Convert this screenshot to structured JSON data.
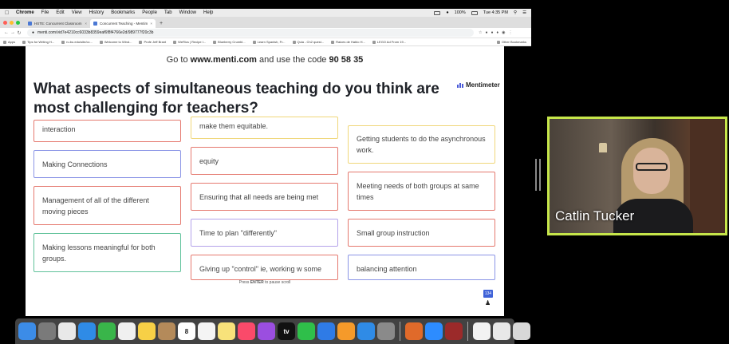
{
  "menubar": {
    "app": "Chrome",
    "items": [
      "File",
      "Edit",
      "View",
      "History",
      "Bookmarks",
      "People",
      "Tab",
      "Window",
      "Help"
    ],
    "battery": "100%",
    "clock": "Tue 4:35 PM"
  },
  "tabs": [
    {
      "label": "HSTE: Concurrent Classroom",
      "active": false
    },
    {
      "label": "Concurrent Teaching - Mentim",
      "active": true
    }
  ],
  "address": {
    "url": "menti.com/vid7e4210cc6033b8359eaf6f8f4766e2d/989777f20c3b"
  },
  "bookmarks": {
    "items": [
      "Apps",
      "Tips for Writing H...",
      "ru.bu.edu/site/cc...",
      "Welcome to Wind...",
      "Profe Jeff Brant",
      "WeRics | Recipe I...",
      "Blueberry Crumbl...",
      "Learn Spanish, Fr...",
      "Quia - Ch2 quest...",
      "Raices de Hablo H...",
      "LEGO Ad From 19..."
    ],
    "other": "Other Bookmarks"
  },
  "menti": {
    "join_prefix": "Go to ",
    "join_site": "www.menti.com",
    "join_middle": " and use the code ",
    "join_code": "90 58 35",
    "question": "What aspects of simultaneous teaching do you think are most challenging for teachers?",
    "logo": "Mentimeter",
    "pause_prefix": "Press ",
    "pause_key": "ENTER",
    "pause_suffix": " to pause scroll",
    "participants": "134"
  },
  "responses": [
    {
      "text": "interaction",
      "color": "#e5796f"
    },
    {
      "text": "Making Connections",
      "color": "#8b95e6"
    },
    {
      "text": "Management of all of the different moving pieces",
      "color": "#e5796f"
    },
    {
      "text": "Making lessons meaningful for both groups.",
      "color": "#5fc29a"
    },
    {
      "text": "make them equitable.",
      "color": "#f0d77a"
    },
    {
      "text": "equity",
      "color": "#e5796f"
    },
    {
      "text": "Ensuring that all needs are being met",
      "color": "#e5796f"
    },
    {
      "text": "Time to plan \"differently\"",
      "color": "#b4a3ea"
    },
    {
      "text": "Giving up \"control\" ie, working w some",
      "color": "#e5796f"
    },
    {
      "text": "Getting students to do the asynchronous work.",
      "color": "#f0d77a"
    },
    {
      "text": "Meeting needs of both groups at same times",
      "color": "#e5796f"
    },
    {
      "text": "Small group instruction",
      "color": "#e5796f"
    },
    {
      "text": "balancing attention",
      "color": "#8b95e6"
    }
  ],
  "video": {
    "name": "Catlin Tucker",
    "border_color": "#c6e64a"
  },
  "dock": {
    "apps": [
      {
        "icon": "finder-icon",
        "color": "#3c8ce7"
      },
      {
        "icon": "launchpad-icon",
        "color": "#7a7a7a"
      },
      {
        "icon": "chrome-icon",
        "color": "#e8e8e8"
      },
      {
        "icon": "safari-icon",
        "color": "#2f8be6"
      },
      {
        "icon": "facetime-icon",
        "color": "#39b54a"
      },
      {
        "icon": "photos-app-icon",
        "color": "#f0f0f0"
      },
      {
        "icon": "photos-icon",
        "color": "#f7d046"
      },
      {
        "icon": "contacts-icon",
        "color": "#b48a5a"
      },
      {
        "icon": "calendar-icon",
        "color": "#ffffff"
      },
      {
        "icon": "reminders-icon",
        "color": "#f4f4f4"
      },
      {
        "icon": "notes-icon",
        "color": "#f8e27a"
      },
      {
        "icon": "music-icon",
        "color": "#fa4a6a"
      },
      {
        "icon": "podcasts-icon",
        "color": "#9b4ee0"
      },
      {
        "icon": "tv-icon",
        "color": "#111111"
      },
      {
        "icon": "numbers-icon",
        "color": "#2fbf4a"
      },
      {
        "icon": "keynote-icon",
        "color": "#2f7be6"
      },
      {
        "icon": "pages-icon",
        "color": "#f59a2a"
      },
      {
        "icon": "app-store-icon",
        "color": "#2f8be6"
      },
      {
        "icon": "system-preferences-icon",
        "color": "#8a8a8a"
      },
      {
        "icon": "garageband-icon",
        "color": "#e06a2a"
      },
      {
        "icon": "zoom-icon",
        "color": "#2d8cff"
      },
      {
        "icon": "dictionary-icon",
        "color": "#9b2a2a"
      },
      {
        "icon": "document-icon",
        "color": "#f2f2f2"
      },
      {
        "icon": "folder-icon",
        "color": "#e8e8e8"
      },
      {
        "icon": "trash-icon",
        "color": "#d8d8d8"
      }
    ],
    "calendar_day": "8",
    "tv_label": "tv"
  }
}
